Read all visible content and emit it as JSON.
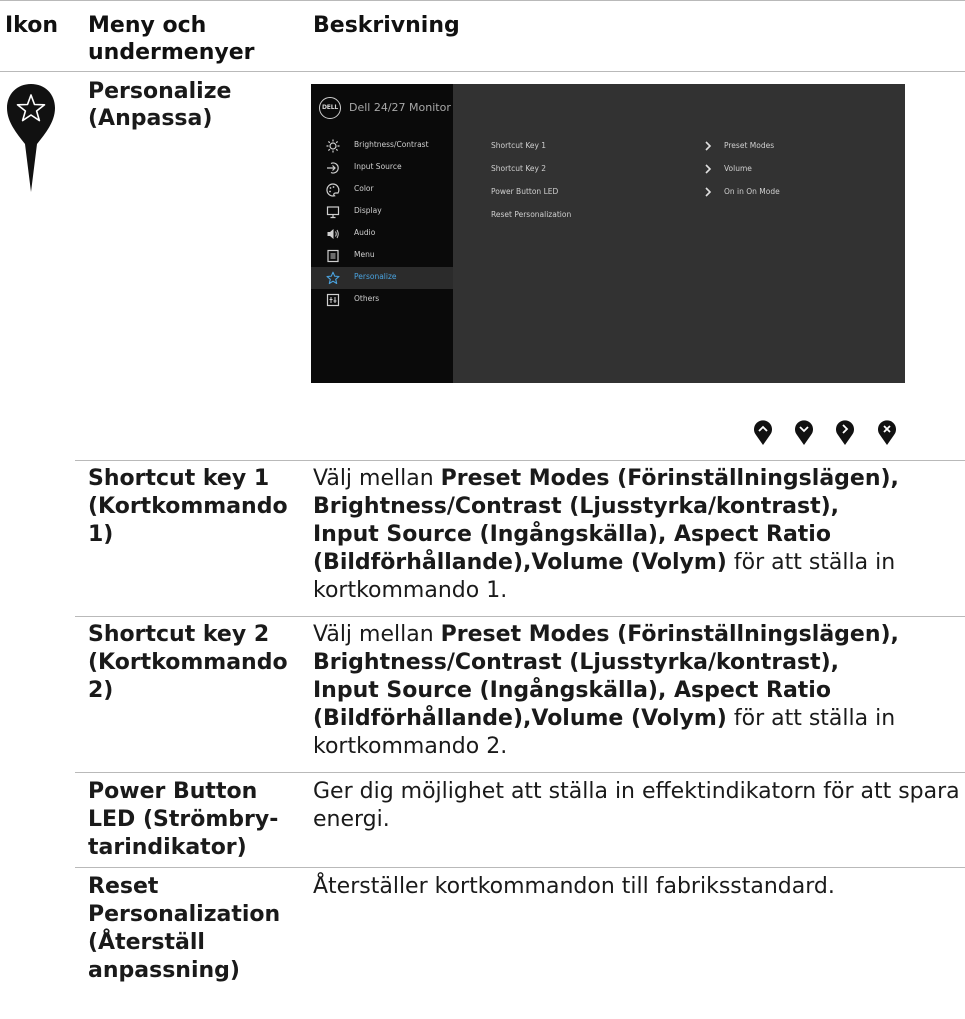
{
  "header": {
    "col_icon": "Ikon",
    "col_menu_line1": "Meny och",
    "col_menu_line2": "undermenyer",
    "col_desc": "Beskrivning"
  },
  "section": {
    "icon": "star-icon",
    "title_line1": "Personalize",
    "title_line2": "(Anpassa)"
  },
  "osd": {
    "logo": "DELL",
    "model": "Dell 24/27 Monitor",
    "menu": [
      {
        "label": "Brightness/Contrast",
        "icon": "sun-icon"
      },
      {
        "label": "Input Source",
        "icon": "input-arrow-icon"
      },
      {
        "label": "Color",
        "icon": "palette-icon"
      },
      {
        "label": "Display",
        "icon": "monitor-icon"
      },
      {
        "label": "Audio",
        "icon": "speaker-icon"
      },
      {
        "label": "Menu",
        "icon": "menu-list-icon"
      },
      {
        "label": "Personalize",
        "icon": "star-icon",
        "active": true
      },
      {
        "label": "Others",
        "icon": "others-icon"
      }
    ],
    "rows": [
      {
        "label": "Shortcut Key 1",
        "value": "Preset Modes"
      },
      {
        "label": "Shortcut Key 2",
        "value": "Volume"
      },
      {
        "label": "Power Button LED",
        "value": "On in On Mode"
      },
      {
        "label": "Reset Personalization",
        "value": ""
      }
    ],
    "accent_color": "#4aa3df"
  },
  "controls": [
    "up-button-icon",
    "down-button-icon",
    "right-button-icon",
    "close-button-icon"
  ],
  "items": [
    {
      "name_lines": [
        "Shortcut key 1",
        "(Kortkommando",
        "1)"
      ],
      "desc_prefix": "Välj mellan ",
      "desc_bold_1": "Preset Modes (Förinställningslägen),",
      "desc_bold_2": "Brightness/Contrast (Ljusstyrka/kontrast),",
      "desc_bold_3": "Input Source (Ingångskälla), Aspect Ratio",
      "desc_bold_4": "(Bildförhållande),Volume (Volym)",
      "desc_suffix_1": " för att ställa in",
      "desc_suffix_2": "kortkommando 1."
    },
    {
      "name_lines": [
        "Shortcut key 2",
        "(Kortkommando",
        "2)"
      ],
      "desc_prefix": "Välj mellan ",
      "desc_bold_1": "Preset Modes (Förinställningslägen),",
      "desc_bold_2": "Brightness/Contrast (Ljusstyrka/kontrast),",
      "desc_bold_3": "Input Source (Ingångskälla), Aspect Ratio",
      "desc_bold_4": "(Bildförhållande),Volume (Volym)",
      "desc_suffix_1": " för att ställa in",
      "desc_suffix_2": "kortkommando 2."
    },
    {
      "name_lines": [
        "Power Button",
        "LED (Strömbry-",
        "tarindikator)"
      ],
      "desc_line1": "Ger dig möjlighet att ställa in effektindikatorn för att spara",
      "desc_line2": "energi."
    },
    {
      "name_lines": [
        "Reset",
        "Personalization",
        "(Återställ",
        "anpassning)"
      ],
      "desc_line1": "Återställer kortkommandon till fabriksstandard."
    }
  ]
}
